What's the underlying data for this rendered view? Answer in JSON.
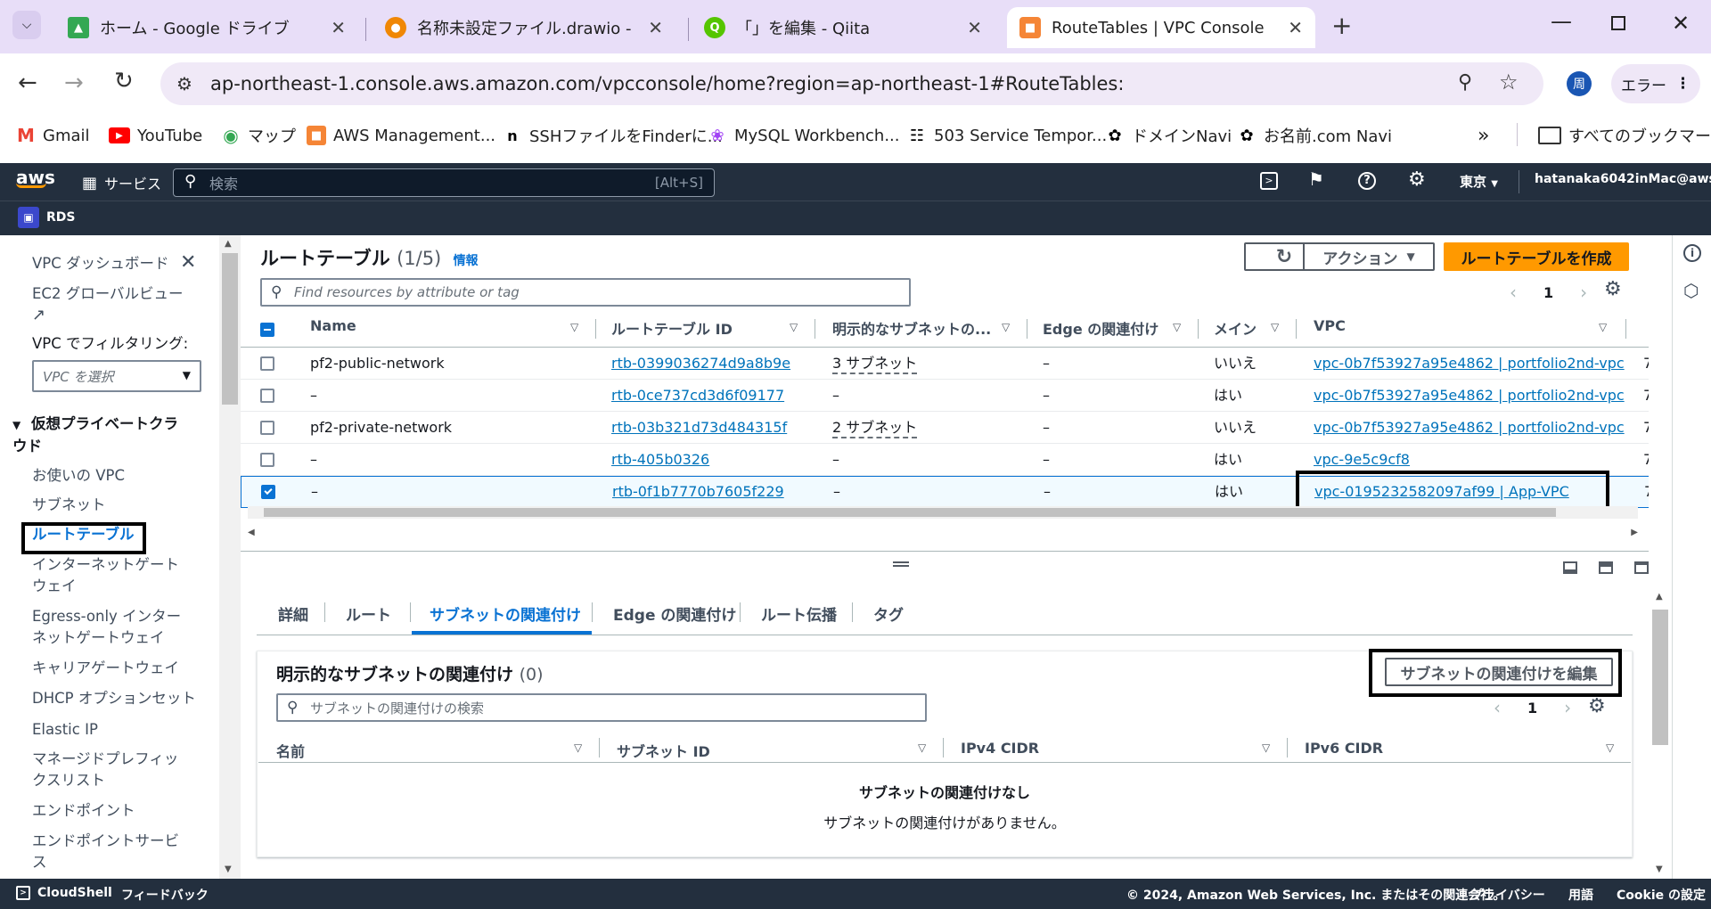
{
  "browser": {
    "tabs": [
      {
        "title": "ホーム - Google ドライブ",
        "icon": "google-drive-icon",
        "color": "#34a853"
      },
      {
        "title": "名称未設定ファイル.drawio - draw",
        "icon": "drawio-icon",
        "color": "#f08705"
      },
      {
        "title": "「」を編集 - Qiita",
        "icon": "qiita-icon",
        "color": "#55c500"
      },
      {
        "title": "RouteTables | VPC Console",
        "icon": "aws-cube-icon",
        "color": "#f58536"
      }
    ],
    "url": "ap-northeast-1.console.aws.amazon.com/vpcconsole/home?region=ap-northeast-1#RouteTables:",
    "profile_initial": "周",
    "error_label": "エラー",
    "bookmarks": [
      {
        "label": "Gmail",
        "icon": "gmail-icon"
      },
      {
        "label": "YouTube",
        "icon": "youtube-icon"
      },
      {
        "label": "マップ",
        "icon": "maps-icon"
      },
      {
        "label": "AWS Management...",
        "icon": "aws-icon"
      },
      {
        "label": "SSHファイルをFinderに...",
        "icon": "notion-icon"
      },
      {
        "label": "MySQL Workbench...",
        "icon": "mysql-icon"
      },
      {
        "label": "503 Service Tempor...",
        "icon": "fork-icon"
      },
      {
        "label": "ドメインNavi",
        "icon": "onamae-icon"
      },
      {
        "label": "お名前.com Navi",
        "icon": "onamae-icon"
      }
    ],
    "all_bookmarks": "すべてのブックマーク"
  },
  "aws": {
    "logo": "aws",
    "services": "サービス",
    "search_placeholder": "検索",
    "search_shortcut": "[Alt+S]",
    "region": "東京",
    "account": "hatanaka6042inMac@aws",
    "rds": "RDS"
  },
  "sidenav": {
    "items": [
      "VPC ダッシュボード",
      "EC2 グローバルビュー",
      "VPC でフィルタリング:",
      "仮想プライベートクラウド",
      "お使いの VPC",
      "サブネット",
      "ルートテーブル",
      "インターネットゲートウェイ",
      "Egress-only インターネットゲートウェイ",
      "キャリアゲートウェイ",
      "DHCP オプションセット",
      "Elastic IP",
      "マネージドプレフィックスリスト",
      "エンドポイント",
      "エンドポイントサービス"
    ],
    "vpc_select": "VPC を選択"
  },
  "main": {
    "title": "ルートテーブル",
    "count": "(1/5)",
    "info": "情報",
    "actions": "アクション",
    "create": "ルートテーブルを作成",
    "filter_placeholder": "Find resources by attribute or tag",
    "page": "1",
    "columns": [
      "Name",
      "ルートテーブル ID",
      "明示的なサブネットの...",
      "Edge の関連付け",
      "メイン",
      "VPC"
    ],
    "rows": [
      {
        "name": "pf2-public-network",
        "id": "rtb-0399036274d9a8b9e",
        "subnet": "3 サブネット",
        "edge": "–",
        "main": "いいえ",
        "vpc": "vpc-0b7f53927a95e4862 | portfolio2nd-vpc",
        "checked": false
      },
      {
        "name": "–",
        "id": "rtb-0ce737cd3d6f09177",
        "subnet": "–",
        "edge": "–",
        "main": "はい",
        "vpc": "vpc-0b7f53927a95e4862 | portfolio2nd-vpc",
        "checked": false
      },
      {
        "name": "pf2-private-network",
        "id": "rtb-03b321d73d484315f",
        "subnet": "2 サブネット",
        "edge": "–",
        "main": "いいえ",
        "vpc": "vpc-0b7f53927a95e4862 | portfolio2nd-vpc",
        "checked": false
      },
      {
        "name": "–",
        "id": "rtb-405b0326",
        "subnet": "–",
        "edge": "–",
        "main": "はい",
        "vpc": "vpc-9e5c9cf8",
        "checked": false
      },
      {
        "name": "–",
        "id": "rtb-0f1b7770b7605f229",
        "subnet": "–",
        "edge": "–",
        "main": "はい",
        "vpc": "vpc-0195232582097af99 | App-VPC",
        "checked": true
      }
    ],
    "cut_col": "7"
  },
  "detail": {
    "tabs": [
      "詳細",
      "ルート",
      "サブネットの関連付け",
      "Edge の関連付け",
      "ルート伝播",
      "タグ"
    ],
    "active_tab": 2,
    "section_title": "明示的なサブネットの関連付け",
    "section_count": "(0)",
    "edit_button": "サブネットの関連付けを編集",
    "search_placeholder": "サブネットの関連付けの検索",
    "page": "1",
    "columns": [
      "名前",
      "サブネット ID",
      "IPv4 CIDR",
      "IPv6 CIDR"
    ],
    "empty_title": "サブネットの関連付けなし",
    "empty_text": "サブネットの関連付けがありません。"
  },
  "footer": {
    "cloudshell": "CloudShell",
    "feedback": "フィードバック",
    "copyright": "© 2024, Amazon Web Services, Inc. またはその関連会社。",
    "privacy": "プライバシー",
    "terms": "用語",
    "cookie": "Cookie の設定"
  }
}
